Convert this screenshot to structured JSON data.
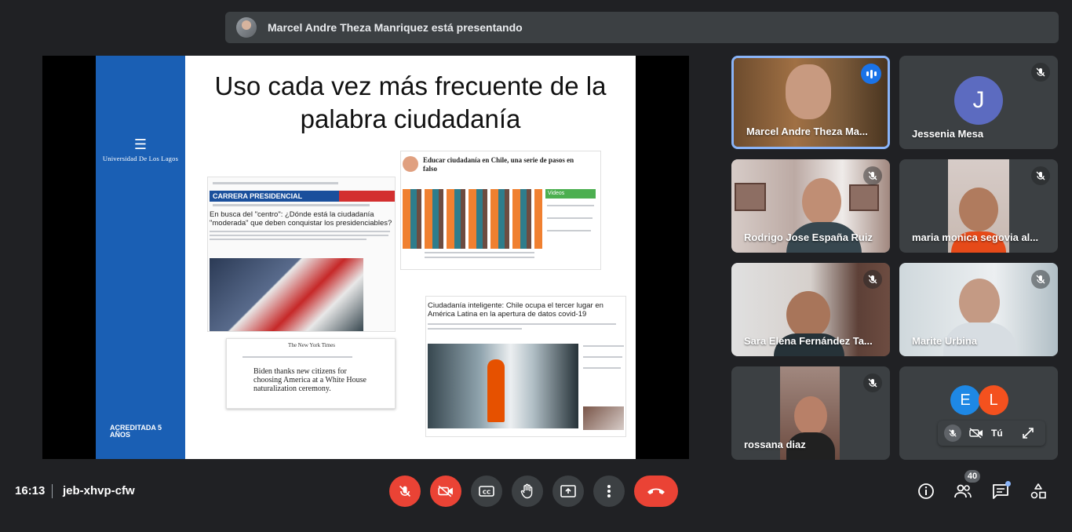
{
  "banner": {
    "presenter_text": "Marcel Andre Theza Manriquez está presentando"
  },
  "slide": {
    "title_line1": "Uso cada vez más frecuente de la",
    "title_line2": "palabra ciudadanía",
    "university": "Universidad De Los Lagos",
    "accreditation": "ACREDITADA 5 AÑOS",
    "clip1_headline": "En busca del \"centro\": ¿Dónde está la ciudadanía \"moderada\" que deben conquistar los presidenciables?",
    "clip1_banner": "CARRERA PRESIDENCIAL",
    "clip2_headline": "Educar ciudadanía en Chile, una serie de pasos en falso",
    "clip2_video": "Videos",
    "clip3_headline": "Ciudadanía inteligente: Chile ocupa el tercer lugar en América Latina en la apertura de datos covid-19",
    "clip4_masthead": "The New York Times",
    "clip4_headline": "Biden thanks new citizens for choosing America at a White House naturalization ceremony."
  },
  "participants": [
    {
      "name": "Marcel Andre Theza Ma...",
      "speaking": true
    },
    {
      "name": "Jessenia Mesa",
      "initial": "J",
      "muted": true
    },
    {
      "name": "Rodrigo Jose España Ruiz",
      "muted": true
    },
    {
      "name": "maria monica segovia al...",
      "muted": true
    },
    {
      "name": "Sara Elena Fernández Ta...",
      "muted": true
    },
    {
      "name": "Marite Urbina",
      "muted": true
    },
    {
      "name": "rossana diaz",
      "muted": true
    }
  ],
  "self_tile": {
    "chips": [
      "E",
      "L"
    ],
    "you_label": "Tú"
  },
  "bottom_bar": {
    "time": "16:13",
    "meeting_code": "jeb-xhvp-cfw",
    "participants_count": "40"
  },
  "colors": {
    "accent": "#8ab4f8",
    "danger": "#ea4335",
    "tile": "#3c4043",
    "background": "#202124"
  }
}
